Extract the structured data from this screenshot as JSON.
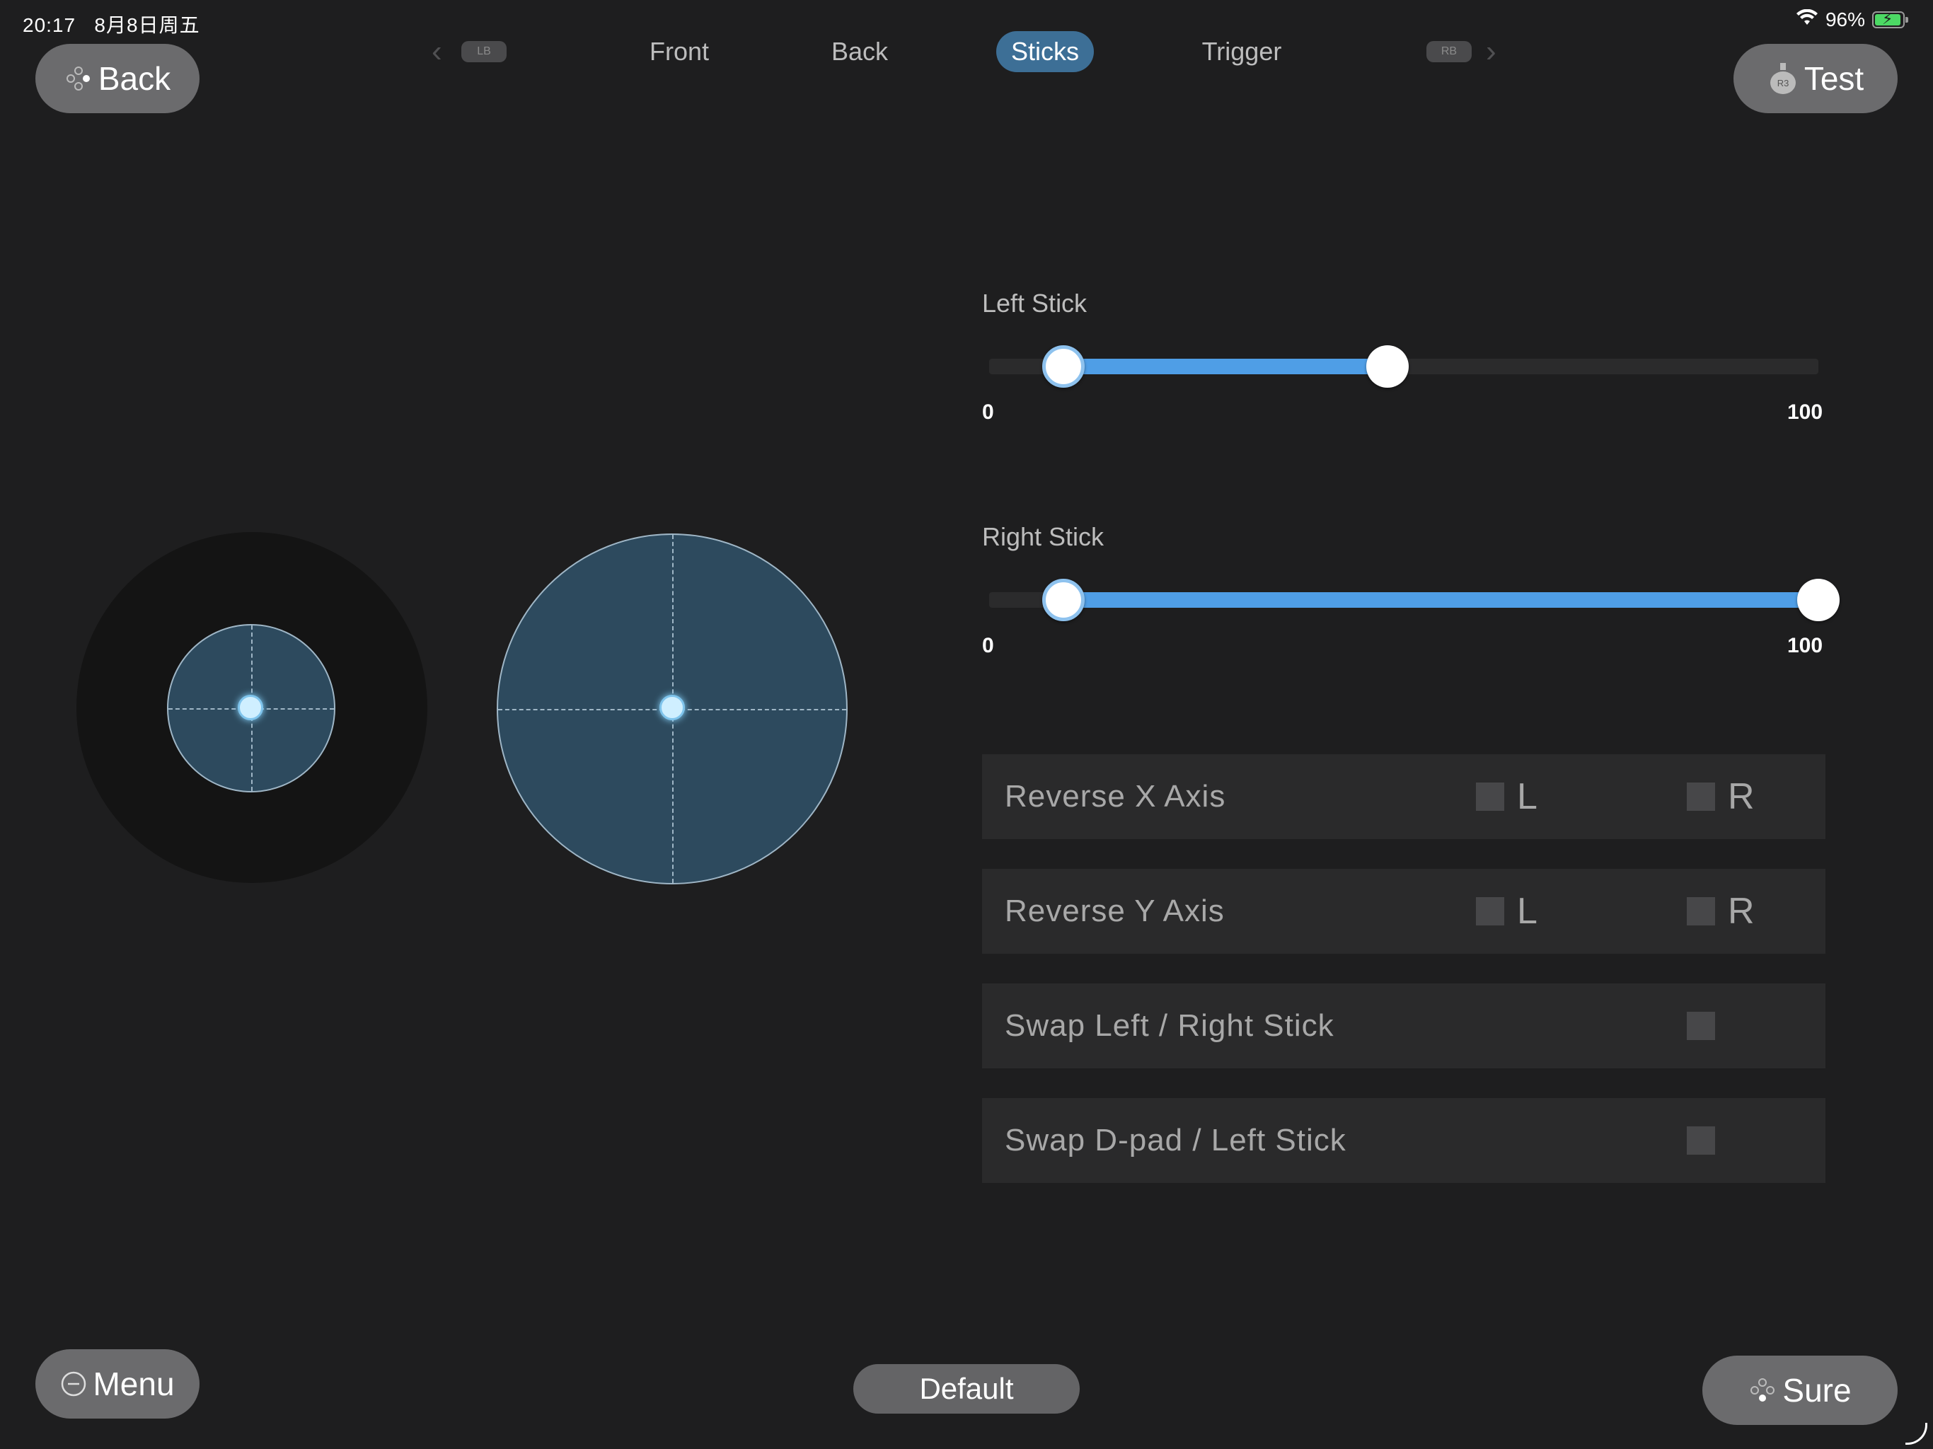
{
  "status_bar": {
    "time": "20:17",
    "date": "8月8日周五",
    "battery": "96%",
    "battery_level": 0.96
  },
  "header": {
    "back_label": "Back",
    "test_label": "Test",
    "test_icon_text": "R3",
    "left_shoulder": "LB",
    "right_shoulder": "RB",
    "tabs": [
      {
        "label": "Front",
        "active": false
      },
      {
        "label": "Back",
        "active": false
      },
      {
        "label": "Sticks",
        "active": true
      },
      {
        "label": "Trigger",
        "active": false
      }
    ]
  },
  "sliders": [
    {
      "label": "Left Stick",
      "min_label": "0",
      "max_label": "100",
      "low": 9,
      "high": 48
    },
    {
      "label": "Right Stick",
      "min_label": "0",
      "max_label": "100",
      "low": 9,
      "high": 100
    }
  ],
  "options": [
    {
      "label": "Reverse X Axis",
      "left_letter": "L",
      "right_letter": "R",
      "left_checked": false,
      "right_checked": false
    },
    {
      "label": "Reverse Y Axis",
      "left_letter": "L",
      "right_letter": "R",
      "left_checked": false,
      "right_checked": false
    },
    {
      "label": "Swap Left / Right Stick",
      "checked": false
    },
    {
      "label": "Swap D-pad / Left Stick",
      "checked": false
    }
  ],
  "footer": {
    "menu_label": "Menu",
    "default_label": "Default",
    "sure_label": "Sure"
  },
  "colors": {
    "accent": "#4f9ee6",
    "tab_active": "#3d6f96",
    "stick_fill": "#2d4a5e"
  }
}
